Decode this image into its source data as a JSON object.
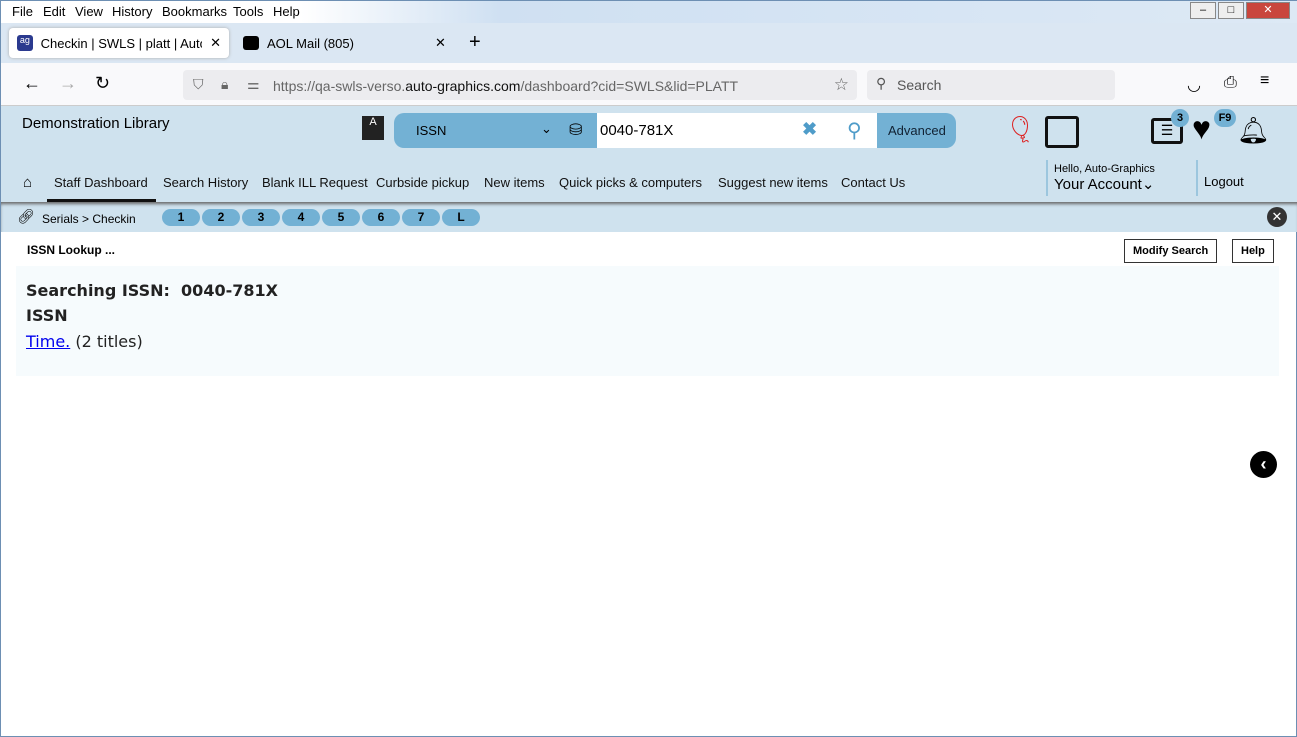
{
  "menu": [
    "File",
    "Edit",
    "View",
    "History",
    "Bookmarks",
    "Tools",
    "Help"
  ],
  "tabs": [
    {
      "title": "Checkin | SWLS | platt | Auto-Gr",
      "icon": "ag-logo-icon"
    },
    {
      "title": "AOL Mail (805)",
      "icon": "aol-icon"
    }
  ],
  "url": {
    "pre": "https://qa-swls-verso.",
    "host": "auto-graphics.com",
    "post": "/dashboard?cid=SWLS&lid=PLATT"
  },
  "browser_search_placeholder": "Search",
  "library_name": "Demonstration Library",
  "search": {
    "type": "ISSN",
    "value": "0040-781X",
    "advanced": "Advanced"
  },
  "badges": {
    "list": "3",
    "favorites": "F9"
  },
  "nav": [
    "Staff Dashboard",
    "Search History",
    "Blank ILL Request",
    "Curbside pickup",
    "New items",
    "Quick picks & computers",
    "Suggest new items",
    "Contact Us"
  ],
  "account": {
    "hello": "Hello, Auto-Graphics",
    "label": "Your Account",
    "logout": "Logout"
  },
  "breadcrumb": "Serials > Checkin",
  "pills": [
    "1",
    "2",
    "3",
    "4",
    "5",
    "6",
    "7",
    "L"
  ],
  "page": {
    "heading": "ISSN Lookup ...",
    "modify": "Modify Search",
    "help": "Help",
    "searching": "Searching ISSN:  0040-781X",
    "label": "ISSN",
    "result_link": "Time.",
    "result_count": "(2 titles)"
  }
}
